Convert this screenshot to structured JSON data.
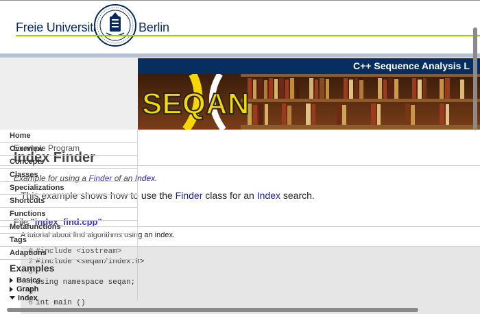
{
  "header": {
    "fu_left": "Freie Universität",
    "fu_right": "Berlin",
    "seal_text": "VERITAS JUSTITIA LIBERTAS · FREIE UNIVERSITÄT BERLIN"
  },
  "seqan": {
    "title_bar": "C++ Sequence Analysis L",
    "logo": "SEQAN"
  },
  "nav": {
    "items": [
      "Home",
      "Overview",
      "Concepts",
      "Classes",
      "Specializations",
      "Shortcuts",
      "Functions",
      "Metafunctions",
      "Tags",
      "Adaptions"
    ],
    "section": "Examples",
    "examples": [
      {
        "label": "Basics",
        "expanded": false
      },
      {
        "label": "Graph",
        "expanded": false
      },
      {
        "label": "Index",
        "expanded": true
      }
    ]
  },
  "main": {
    "breadcrumb": "Example Program",
    "title": "Index Finder",
    "subtitle_prefix": "Example for using a ",
    "subtitle_link1": "Finder",
    "subtitle_mid": " of an ",
    "subtitle_link2": "Index",
    "subtitle_suffix": ".",
    "desc_prefix": "This example shows how to use the ",
    "desc_link1": "Finder",
    "desc_mid": " class for an ",
    "desc_link2": "Index",
    "desc_suffix": " search.",
    "file_prefix": "File ",
    "file_name": "\"index_find.cpp\"",
    "tutorial": "A tutorial about find algorithms using an index.",
    "code": [
      {
        "n": "1",
        "text": "#include <iostream>"
      },
      {
        "n": "2",
        "text": "#include <seqan/index.h>"
      },
      {
        "n": "3",
        "text": ""
      },
      {
        "n": "4",
        "text": "using namespace seqan;"
      },
      {
        "n": "5",
        "text": ""
      },
      {
        "n": "6",
        "text": "int main ()"
      }
    ]
  },
  "colors": {
    "fu_blue": "#06285a",
    "fu_green": "#99cc00",
    "seqan_bar": "#062f60",
    "link": "#1a1a9a",
    "code_bg": "#e6e6e6"
  }
}
